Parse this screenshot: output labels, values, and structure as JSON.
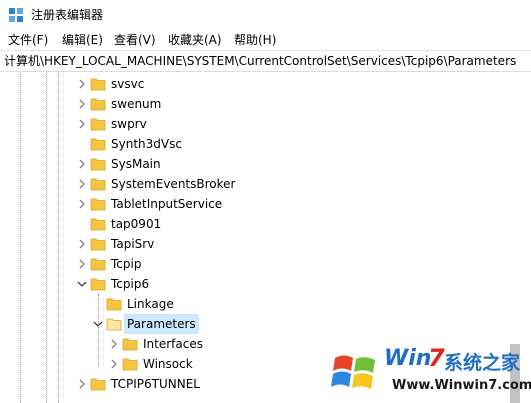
{
  "window": {
    "title": "注册表编辑器",
    "icon": "regedit-icon"
  },
  "menu": [
    "文件(F)",
    "编辑(E)",
    "查看(V)",
    "收藏夹(A)",
    "帮助(H)"
  ],
  "address": "计算机\\HKEY_LOCAL_MACHINE\\SYSTEM\\CurrentControlSet\\Services\\Tcpip6\\Parameters",
  "tree": [
    {
      "label": "svsvc",
      "expanded": false,
      "selected": false
    },
    {
      "label": "swenum",
      "expanded": false,
      "selected": false
    },
    {
      "label": "swprv",
      "expanded": false,
      "selected": false
    },
    {
      "label": "Synth3dVsc",
      "expanded": false,
      "selected": false
    },
    {
      "label": "SysMain",
      "expanded": false,
      "selected": false
    },
    {
      "label": "SystemEventsBroker",
      "expanded": false,
      "selected": false
    },
    {
      "label": "TabletInputService",
      "expanded": false,
      "selected": false
    },
    {
      "label": "tap0901",
      "expanded": false,
      "selected": false
    },
    {
      "label": "TapiSrv",
      "expanded": false,
      "selected": false
    },
    {
      "label": "Tcpip",
      "expanded": false,
      "selected": false
    },
    {
      "label": "Tcpip6",
      "expanded": true,
      "selected": false
    },
    {
      "label": "Linkage",
      "expanded": null,
      "selected": false
    },
    {
      "label": "Parameters",
      "expanded": true,
      "selected": true
    },
    {
      "label": "Interfaces",
      "expanded": false,
      "selected": false
    },
    {
      "label": "Winsock",
      "expanded": false,
      "selected": false
    },
    {
      "label": "TCPIP6TUNNEL",
      "expanded": false,
      "selected": false
    }
  ],
  "watermark": {
    "brand_a": "Win",
    "brand_num": "7",
    "brand_b": "系统之家",
    "url": "Www.Winwin7.com"
  },
  "colors": {
    "folder": "#f5c542",
    "selection": "#cce8ff",
    "wm_blue": "#1e6fc4",
    "wm_red": "#d9271c"
  }
}
